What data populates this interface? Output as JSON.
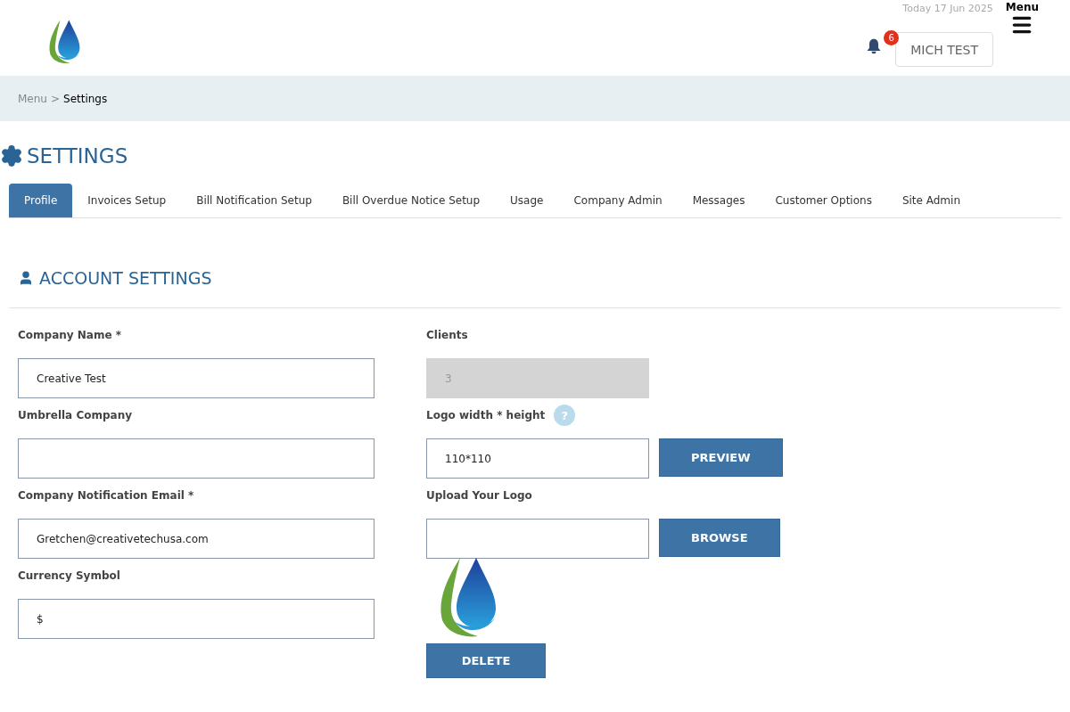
{
  "header": {
    "date": "Today 17 Jun 2025",
    "menu_label": "Menu",
    "notification_count": "6",
    "user_button": "MICH TEST"
  },
  "breadcrumb": {
    "items": [
      "Menu",
      "Settings"
    ],
    "separator": ">"
  },
  "page_title": "SETTINGS",
  "tabs": [
    {
      "label": "Profile",
      "selected": true
    },
    {
      "label": "Invoices Setup",
      "selected": false
    },
    {
      "label": "Bill Notification Setup",
      "selected": false
    },
    {
      "label": "Bill Overdue Notice Setup",
      "selected": false
    },
    {
      "label": "Usage",
      "selected": false
    },
    {
      "label": "Company Admin",
      "selected": false
    },
    {
      "label": "Messages",
      "selected": false
    },
    {
      "label": "Customer Options",
      "selected": false
    },
    {
      "label": "Site Admin",
      "selected": false
    }
  ],
  "section_title": "ACCOUNT SETTINGS",
  "left_fields": [
    {
      "label": "Company Name *",
      "value": "Creative Test"
    },
    {
      "label": "Umbrella Company"
    },
    {
      "label": "Company Notification Email *",
      "value": "Gretchen@creativetechusa.com"
    },
    {
      "label": "Currency Symbol",
      "value": "$"
    }
  ],
  "right_fields": [
    {
      "label": "Clients",
      "value": "3",
      "disabled": true
    },
    {
      "label": "Logo width * height",
      "value": "110*110",
      "disabled": false,
      "help": "?",
      "button": "PREVIEW"
    },
    {
      "label": "Upload Your Logo",
      "disabled": false,
      "button": "BROWSE"
    }
  ],
  "delete_button": "DELETE"
}
